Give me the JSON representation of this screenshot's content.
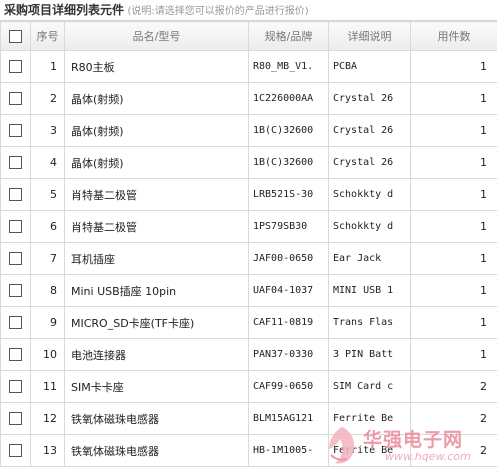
{
  "header": {
    "title": "采购项目详细列表元件",
    "note": "(说明:请选择您可以报价的产品进行报价)"
  },
  "table": {
    "columns": [
      "序号",
      "品名/型号",
      "规格/品牌",
      "详细说明",
      "用件数"
    ],
    "rows": [
      {
        "no": "1",
        "name": "R80主板",
        "spec": "R80_MB_V1.",
        "desc": "PCBA",
        "qty": "1"
      },
      {
        "no": "2",
        "name": "晶体(射频)",
        "spec": "1C226000AA",
        "desc": "Crystal 26",
        "qty": "1"
      },
      {
        "no": "3",
        "name": "晶体(射频)",
        "spec": "1B(C)32600",
        "desc": "Crystal 26",
        "qty": "1"
      },
      {
        "no": "4",
        "name": "晶体(射频)",
        "spec": "1B(C)32600",
        "desc": "Crystal 26",
        "qty": "1"
      },
      {
        "no": "5",
        "name": "肖特基二极管",
        "spec": "LRB521S-30",
        "desc": "Schokkty d",
        "qty": "1"
      },
      {
        "no": "6",
        "name": "肖特基二极管",
        "spec": "1PS79SB30",
        "desc": "Schokkty d",
        "qty": "1"
      },
      {
        "no": "7",
        "name": "耳机插座",
        "spec": "JAF00-0650",
        "desc": "Ear Jack",
        "qty": "1"
      },
      {
        "no": "8",
        "name": "Mini USB插座 10pin",
        "spec": "UAF04-1037",
        "desc": "MINI USB 1",
        "qty": "1"
      },
      {
        "no": "9",
        "name": "MICRO_SD卡座(TF卡座)",
        "spec": "CAF11-0819",
        "desc": "Trans Flas",
        "qty": "1"
      },
      {
        "no": "10",
        "name": "电池连接器",
        "spec": "PAN37-0330",
        "desc": "3 PIN Batt",
        "qty": "1"
      },
      {
        "no": "11",
        "name": "SIM卡卡座",
        "spec": "CAF99-0650",
        "desc": "SIM Card c",
        "qty": "2"
      },
      {
        "no": "12",
        "name": "铁氧体磁珠电感器",
        "spec": "BLM15AG121",
        "desc": "Ferrite Be",
        "qty": "2"
      },
      {
        "no": "13",
        "name": "铁氧体磁珠电感器",
        "spec": "HB-1M1005-",
        "desc": "Ferrite Be",
        "qty": "2"
      }
    ]
  },
  "watermark": {
    "text": "华强电子网",
    "url": "www.hqew.com"
  }
}
